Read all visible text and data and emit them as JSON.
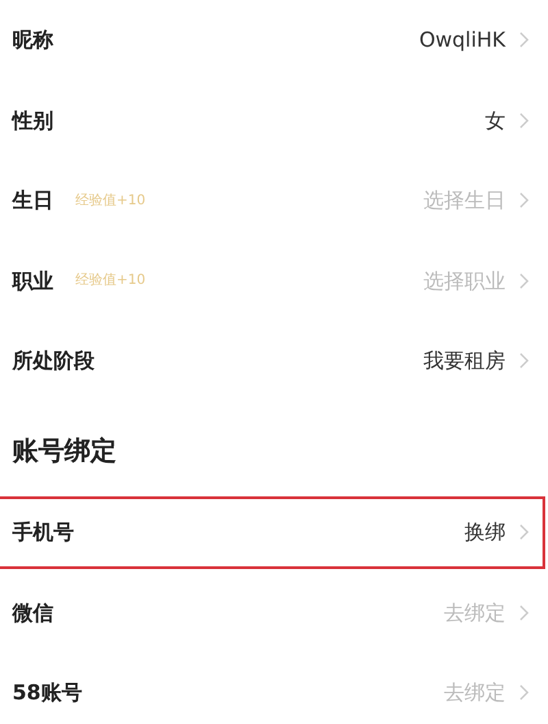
{
  "profile_rows": [
    {
      "label": "昵称",
      "value": "OwqliHK",
      "filled": true
    },
    {
      "label": "性别",
      "value": "女",
      "filled": true
    },
    {
      "label": "生日",
      "badge": "经验值+10",
      "value": "选择生日",
      "filled": false
    },
    {
      "label": "职业",
      "badge": "经验值+10",
      "value": "选择职业",
      "filled": false
    },
    {
      "label": "所处阶段",
      "value": "我要租房",
      "filled": true
    }
  ],
  "binding_section": {
    "title": "账号绑定",
    "rows": [
      {
        "label": "手机号",
        "value": "换绑",
        "filled": true,
        "highlighted": true
      },
      {
        "label": "微信",
        "value": "去绑定",
        "filled": false,
        "highlighted": false
      },
      {
        "label": "58账号",
        "value": "去绑定",
        "filled": false,
        "highlighted": false
      }
    ]
  }
}
